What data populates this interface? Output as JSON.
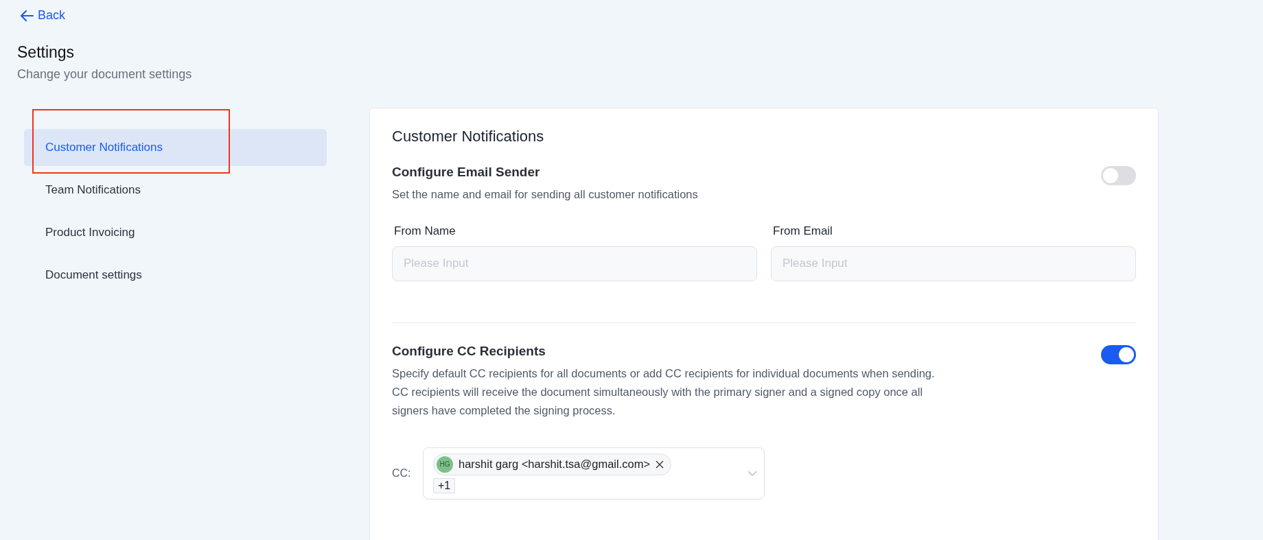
{
  "back": {
    "label": "Back"
  },
  "header": {
    "title": "Settings",
    "subtitle": "Change your document settings"
  },
  "sidebar": {
    "items": [
      {
        "label": "Customer Notifications",
        "selected": true,
        "highlighted": true
      },
      {
        "label": "Team Notifications",
        "selected": false,
        "highlighted": false
      },
      {
        "label": "Product Invoicing",
        "selected": false,
        "highlighted": false
      },
      {
        "label": "Document settings",
        "selected": false,
        "highlighted": false
      }
    ]
  },
  "panel": {
    "title": "Customer Notifications",
    "sections": [
      {
        "kind": "fields",
        "title": "Configure Email Sender",
        "on": false,
        "description": [
          "Set the name and email for sending all customer notifications"
        ],
        "fields": [
          {
            "label": "From Name",
            "placeholder": "Please Input"
          },
          {
            "label": "From Email",
            "placeholder": "Please Input"
          }
        ]
      },
      {
        "kind": "cc",
        "title": "Configure CC Recipients",
        "on": true,
        "description": [
          "Specify default CC recipients for all documents or add CC recipients for individual documents when sending.",
          "CC recipients will receive the document simultaneously with the primary signer and a signed copy once all",
          "signers have completed the signing process."
        ],
        "cc": {
          "label": "CC:",
          "tags": [
            {
              "initials": "HG",
              "text": "harshit garg <harshit.tsa@gmail.com>",
              "color": "#7cc08a"
            }
          ],
          "more": "+1"
        }
      }
    ]
  }
}
